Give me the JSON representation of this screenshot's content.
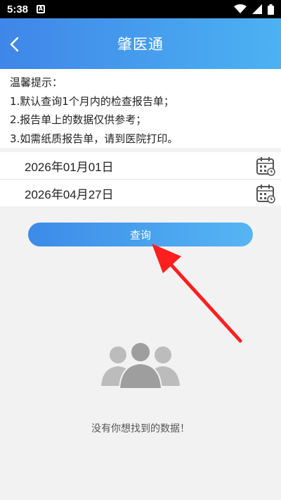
{
  "status_bar": {
    "time": "5:38",
    "notif": "A"
  },
  "header": {
    "title": "肇医通"
  },
  "notice": {
    "lines": [
      "温馨提示：",
      "1.默认查询1个月内的检查报告单；",
      "2.报告单上的数据仅供参考；",
      "3.如需纸质报告单，请到医院打印。"
    ]
  },
  "date_range": {
    "start": "2026年01月01日",
    "end": "2026年04月27日"
  },
  "query_button": {
    "label": "查询"
  },
  "empty_state": {
    "message": "没有你想找到的数据！"
  },
  "icons": {
    "back": "chevron-left-icon",
    "calendar": "calendar-icon",
    "empty": "users-group-icon",
    "wifi": "wifi-icon",
    "signal": "signal-icon",
    "battery": "battery-icon"
  },
  "colors": {
    "header_start": "#3f86e8",
    "header_end": "#4cb2f2",
    "arrow": "#ff1f1f"
  }
}
